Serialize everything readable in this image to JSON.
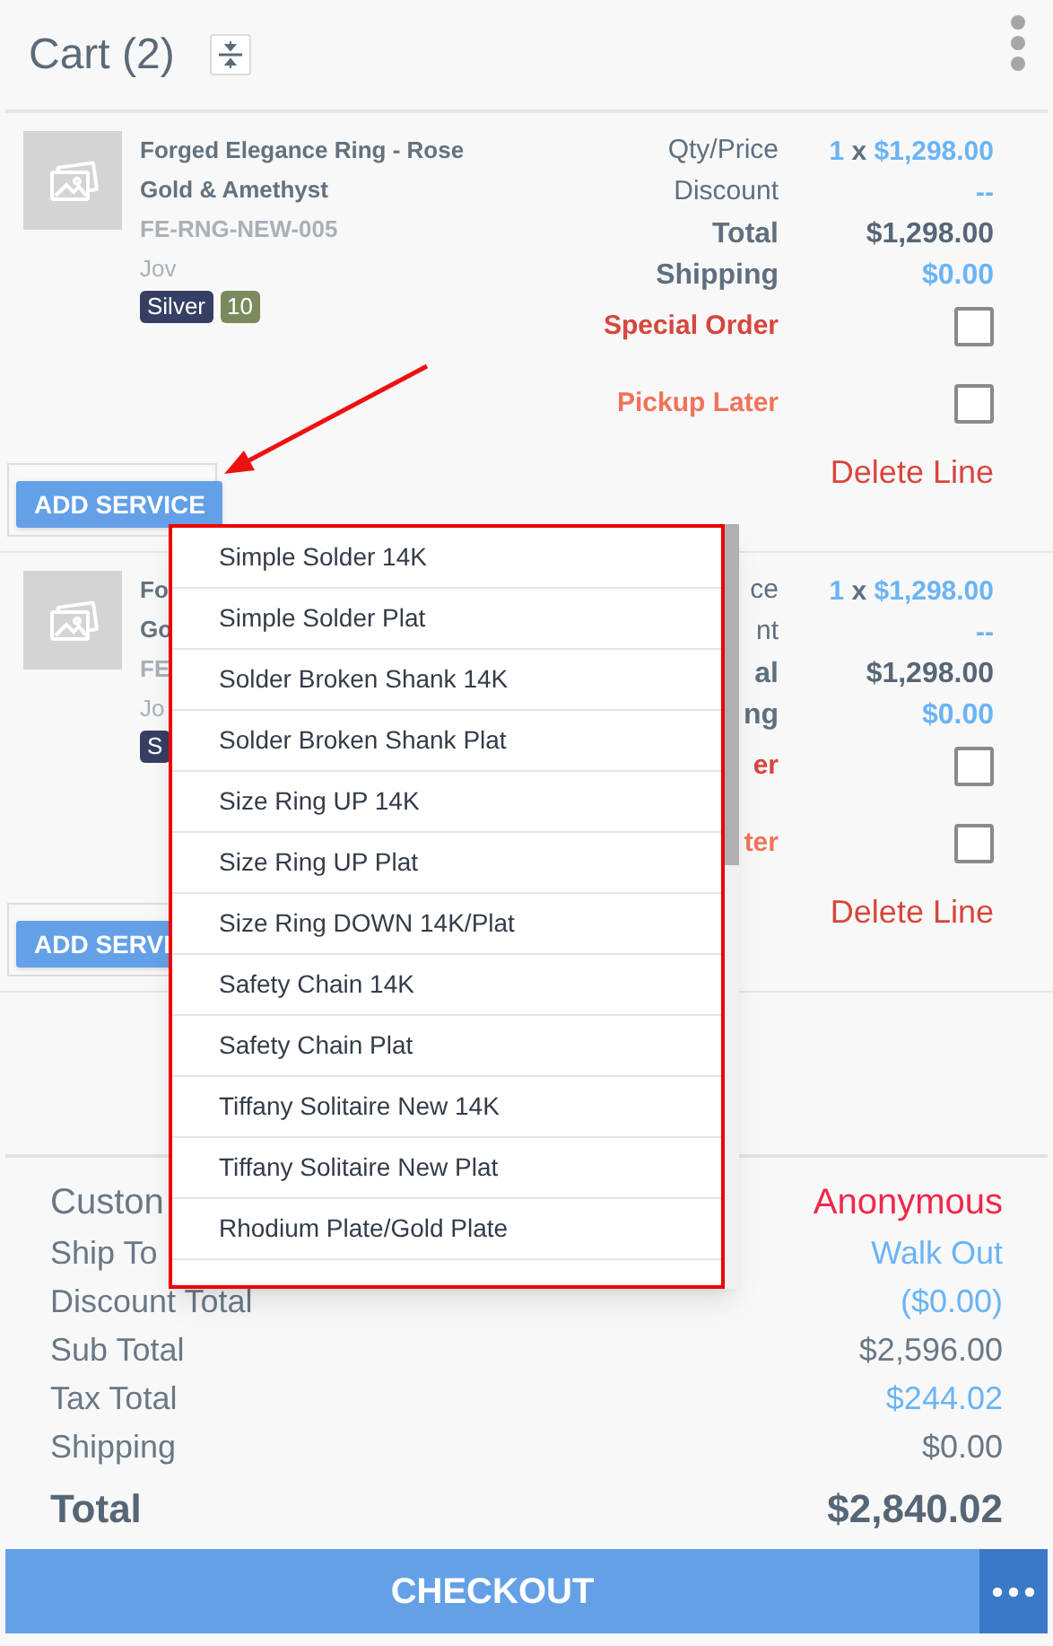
{
  "header": {
    "title": "Cart (2)"
  },
  "items": [
    {
      "name_lines": [
        "Forged Elegance Ring - Rose",
        "Gold & Amethyst"
      ],
      "sku": "FE-RNG-NEW-005",
      "vendor": "Jov",
      "badges": [
        {
          "label": "Silver",
          "color": "#363f63"
        },
        {
          "label": "10",
          "color": "#7b8a5c"
        }
      ],
      "rows": [
        {
          "kind": "qty",
          "label": "Qty/Price",
          "qty": "1",
          "sep": "x",
          "price": "$1,298.00"
        },
        {
          "kind": "link",
          "label": "Discount",
          "value": "--"
        },
        {
          "kind": "strong",
          "label": "Total",
          "value": "$1,298.00"
        },
        {
          "kind": "link-strong",
          "label": "Shipping",
          "value": "$0.00"
        }
      ],
      "checks": [
        {
          "label": "Special Order",
          "kind": "special",
          "checked": false
        },
        {
          "label": "Pickup Later",
          "kind": "pickup",
          "checked": false
        }
      ],
      "delete": "Delete Line",
      "add_service": "ADD SERVICE"
    },
    {
      "name_lines": [
        "Fo",
        "Go"
      ],
      "sku": "FE",
      "vendor": "Jo",
      "badges": [
        {
          "label": "S",
          "color": "#363f63"
        }
      ],
      "rows": [
        {
          "kind": "qty",
          "label": "ce",
          "qty": "1",
          "sep": "x",
          "price": "$1,298.00"
        },
        {
          "kind": "link",
          "label": "nt",
          "value": "--"
        },
        {
          "kind": "strong",
          "label": "al",
          "value": "$1,298.00"
        },
        {
          "kind": "link-strong",
          "label": "ng",
          "value": "$0.00"
        }
      ],
      "checks": [
        {
          "label": "er",
          "kind": "special",
          "checked": false
        },
        {
          "label": "ter",
          "kind": "pickup",
          "checked": false
        }
      ],
      "delete": "Delete Line",
      "add_service": "ADD SERVI"
    }
  ],
  "service_menu": [
    "Simple Solder 14K",
    "Simple Solder Plat",
    "Solder Broken Shank 14K",
    "Solder Broken Shank Plat",
    "Size Ring UP 14K",
    "Size Ring UP Plat",
    "Size Ring DOWN 14K/Plat",
    "Safety Chain 14K",
    "Safety Chain Plat",
    "Tiffany Solitaire New 14K",
    "Tiffany Solitaire New Plat",
    "Rhodium Plate/Gold Plate"
  ],
  "summary": [
    {
      "kind": "customer",
      "label": "Custon",
      "value": "Anonymous"
    },
    {
      "kind": "link",
      "label": "Ship To",
      "value": "Walk Out"
    },
    {
      "kind": "link",
      "label": "Discount Total",
      "value": "($0.00)"
    },
    {
      "kind": "plain",
      "label": "Sub Total",
      "value": "$2,596.00"
    },
    {
      "kind": "link",
      "label": "Tax Total",
      "value": "$244.02"
    },
    {
      "kind": "plain",
      "label": "Shipping",
      "value": "$0.00"
    },
    {
      "kind": "total",
      "label": "Total",
      "value": "$2,840.02"
    }
  ],
  "checkout": "CHECKOUT"
}
